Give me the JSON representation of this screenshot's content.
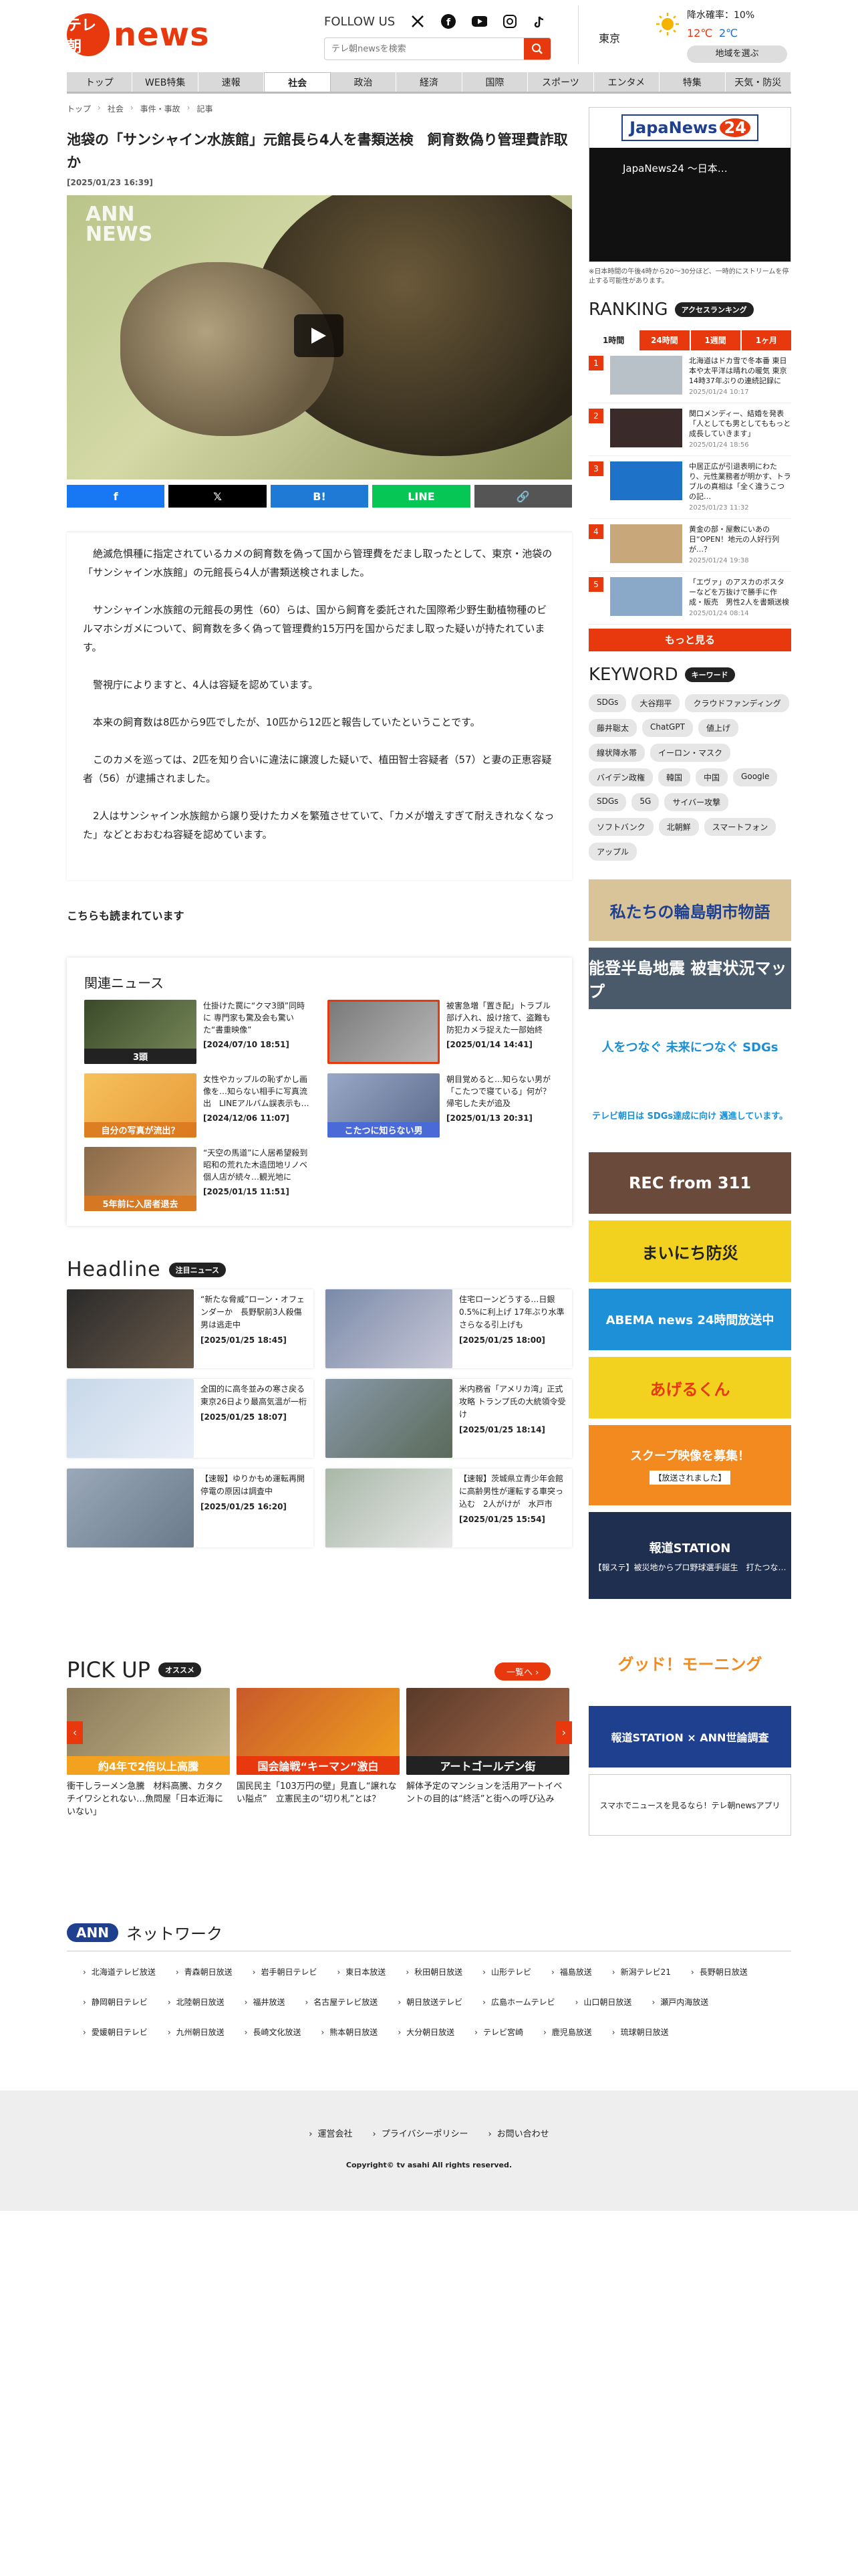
{
  "header": {
    "logo_mark": "テレ朝",
    "logo_word": "news",
    "follow_label": "FOLLOW US",
    "search_placeholder": "テレ朝newsを検索"
  },
  "weather": {
    "city": "東京",
    "rain": "降水確率：10%",
    "high": "12℃",
    "low": "2℃",
    "button": "地域を選ぶ"
  },
  "nav": [
    "トップ",
    "WEB特集",
    "速報",
    "社会",
    "政治",
    "経済",
    "国際",
    "スポーツ",
    "エンタメ",
    "特集",
    "天気・防災"
  ],
  "breadcrumb": [
    "トップ",
    "社会",
    "事件・事故",
    "記事"
  ],
  "article": {
    "title": "池袋の「サンシャイン水族館」元館長ら4人を書類送検　飼育数偽り管理費詐取か",
    "date": "[2025/01/23 16:39]",
    "video_watermark": "ANN\nNEWS",
    "paragraphs": [
      "絶滅危惧種に指定されているカメの飼育数を偽って国から管理費をだまし取ったとして、東京・池袋の「サンシャイン水族館」の元館長ら4人が書類送検されました。",
      "サンシャイン水族館の元館長の男性（60）らは、国から飼育を委託された国際希少野生動植物種のビルマホシガメについて、飼育数を多く偽って管理費約15万円を国からだまし取った疑いが持たれています。",
      "警視庁によりますと、4人は容疑を認めています。",
      "本来の飼育数は8匹から9匹でしたが、10匹から12匹と報告していたということです。",
      "このカメを巡っては、2匹を知り合いに違法に譲渡した疑いで、植田智士容疑者（57）と妻の正恵容疑者（56）が逮捕されました。",
      "2人はサンシャイン水族館から譲り受けたカメを繁殖させていて、「カメが増えすぎて耐えきれなくなった」などとおおむね容疑を認めています。"
    ],
    "also_read": "こちらも読まれています"
  },
  "share": [
    {
      "label": "f",
      "color": "#1877f2"
    },
    {
      "label": "𝕏",
      "color": "#000000"
    },
    {
      "label": "B!",
      "color": "#1e7ad4"
    },
    {
      "label": "LINE",
      "color": "#06c755"
    },
    {
      "label": "🔗",
      "color": "#555555"
    }
  ],
  "related": {
    "title": "関連ニュース",
    "items": [
      {
        "text": "仕掛けた罠に“クマ3頭”同時に 専門家も驚及会も驚いた“書重映像”",
        "date": "[2024/07/10 18:51]",
        "cap": "3頭"
      },
      {
        "text": "被害急増「置き配」トラブル　部げ入れ、設け捨て、盗難も　防犯カメラ捉えた一部始終",
        "date": "[2025/01/14 14:41]",
        "cap": ""
      },
      {
        "text": "女性やカップルの恥ずかし画像を…知らない相手に写真流出　LINEアルバム誤表示も…",
        "date": "[2024/12/06 11:07]",
        "cap": "自分の写真が流出？"
      },
      {
        "text": "朝目覚めると…知らない男が「こたつで寝ている」何が？帰宅した夫が追及",
        "date": "[2025/01/13 20:31]",
        "cap": "こたつに知らない男"
      },
      {
        "text": "“天空の馬道”に人居希望殺到　昭和の荒れた木造団地リノベ　個人店が続々…観光地に",
        "date": "[2025/01/15 11:51]",
        "cap": "5年前に入居者退去"
      }
    ]
  },
  "headline": {
    "title": "Headline",
    "badge": "注目ニュース",
    "items": [
      {
        "text": "“新たな脅威”ローン・オフェンダーか　長野駅前3人殺傷　男は逃走中",
        "date": "[2025/01/25 18:45]"
      },
      {
        "text": "住宅ローンどうする…日銀0.5%に利上げ 17年ぶり水準 さらなる引上げも",
        "date": "[2025/01/25 18:00]"
      },
      {
        "text": "全国的に高冬並みの寒さ戻る 東京26日より最高気温が一桁",
        "date": "[2025/01/25 18:07]"
      },
      {
        "text": "米内務省「アメリカ湾」正式攻略 トランプ氏の大統領令受け",
        "date": "[2025/01/25 18:14]"
      },
      {
        "text": "【速報】ゆりかもめ運転再開　停電の原因は調査中",
        "date": "[2025/01/25 16:20]"
      },
      {
        "text": "【速報】茨城県立青少年会館に高齢男性が運転する車突っ込む　2人がけが　水戸市",
        "date": "[2025/01/25 15:54]"
      }
    ]
  },
  "pickup": {
    "title": "PICK UP",
    "badge": "オススメ",
    "all": "一覧へ ›",
    "items": [
      {
        "text": "衝干しラーメン急騰　材料高騰、カタクチイワシとれない…魚問屋「日本近海にいない」",
        "cap": "約4年で2倍以上高騰"
      },
      {
        "text": "国民民主「103万円の壁」見直し“譲れない隘点”　立憲民主の“切り札”とは？",
        "cap": "国会論戦“キーマン”激白"
      },
      {
        "text": "解体予定のマンションを活用アートイベントの目的は“終活”と街への呼び込み",
        "cap": "アートゴールデン街"
      }
    ]
  },
  "sidebar": {
    "jn_logo": "JapaNews",
    "jn_num": "24",
    "jn_video": "JapaNews24 〜日本…",
    "jn_note": "※日本時間の午後4時から20〜30分ほど、一時的にストリームを停止する可能性があります。",
    "ranking_title": "RANKING",
    "ranking_badge": "アクセスランキング",
    "tabs": [
      "1時間",
      "24時間",
      "1週間",
      "1ヶ月"
    ],
    "ranking": [
      {
        "n": "1",
        "text": "北海道はドカ雪で冬本番 東日本や太平洋は晴れの暖気 東京14時37年ぶりの連続記録に",
        "date": "2025/01/24 10:17"
      },
      {
        "n": "2",
        "text": "関口メンディー、結婚を発表 「人としても男としてももっと成長していきます」",
        "date": "2025/01/24 18:56"
      },
      {
        "n": "3",
        "text": "中居正広が引退表明にわたり、元性業務者が明かす、トラブルの真相は「全く違うこつの記…",
        "date": "2025/01/23 11:32"
      },
      {
        "n": "4",
        "text": "黄金の部・屋敷にいあの日“OPEN！地元の人好行列が…？",
        "date": "2025/01/24 19:38"
      },
      {
        "n": "5",
        "text": "「エヴァ」のアスカのボスターなどを万抜けで勝手に作成・販売　男性2人を書類送検",
        "date": "2025/01/24 08:14"
      }
    ],
    "more": "もっと見る",
    "keyword_title": "KEYWORD",
    "keyword_badge": "キーワード",
    "keywords": [
      "SDGs",
      "大谷翔平",
      "クラウドファンディング",
      "藤井聡太",
      "ChatGPT",
      "値上げ",
      "線状降水帯",
      "イーロン・マスク",
      "バイデン政権",
      "韓国",
      "中国",
      "Google",
      "SDGs",
      "5G",
      "サイバー攻撃",
      "ソフトバンク",
      "北朝鮮",
      "スマートフォン",
      "アップル"
    ],
    "banners": [
      {
        "text": "私たちの輪島朝市物語",
        "bg": "#d9c49a",
        "fg": "#1f3f8f"
      },
      {
        "text": "能登半島地震 被害状況マップ",
        "bg": "#4a5a6a",
        "fg": "#ffffff"
      },
      {
        "text": "人をつなぐ 未来につなぐ SDGs",
        "bg": "#ffffff",
        "fg": "#1a8fd8"
      },
      {
        "text": "テレビ朝日は SDGs達成に向け 邁進しています。",
        "bg": "#ffffff",
        "fg": "#1a8fd8"
      },
      {
        "text": "REC from 311",
        "bg": "#6a4a3a",
        "fg": "#ffffff"
      },
      {
        "text": "まいにち防災",
        "bg": "#f2d11f",
        "fg": "#222222"
      },
      {
        "text": "ABEMA news 24時間放送中",
        "bg": "#1e90d8",
        "fg": "#ffffff"
      },
      {
        "text": "あげるくん",
        "bg": "#f2d11f",
        "fg": "#e8380d"
      },
      {
        "text": "スクープ映像を募集！",
        "bg": "#f28a1f",
        "fg": "#ffffff"
      },
      {
        "text": "報道STATION",
        "bg": "#1f2f4f",
        "fg": "#ffffff"
      },
      {
        "text": "グッド！モーニング",
        "bg": "#ffffff",
        "fg": "#f28a1f"
      },
      {
        "text": "報道STATION × ANN世論調査",
        "bg": "#1f3f8f",
        "fg": "#ffffff"
      },
      {
        "text": "スマホでニュースを見るなら！テレ朝newsアプリ",
        "bg": "#ffffff",
        "fg": "#222222"
      }
    ],
    "scoop_text": "【放送されました】",
    "hs_text": "【報ステ】被災地からプロ野球選手誕生　打たつな…"
  },
  "network": {
    "ann": "ANN",
    "title": "ネットワーク",
    "stations": [
      "北海道テレビ放送",
      "青森朝日放送",
      "岩手朝日テレビ",
      "東日本放送",
      "秋田朝日放送",
      "山形テレビ",
      "福島放送",
      "新潟テレビ21",
      "長野朝日放送",
      "静岡朝日テレビ",
      "北陸朝日放送",
      "福井放送",
      "名古屋テレビ放送",
      "朝日放送テレビ",
      "広島ホームテレビ",
      "山口朝日放送",
      "瀬戸内海放送",
      "愛媛朝日テレビ",
      "九州朝日放送",
      "長崎文化放送",
      "熊本朝日放送",
      "大分朝日放送",
      "テレビ宮崎",
      "鹿児島放送",
      "琉球朝日放送"
    ]
  },
  "footer": {
    "links": [
      "運営会社",
      "プライバシーポリシー",
      "お問い合わせ"
    ],
    "copyright": "Copyright© tv asahi All rights reserved."
  }
}
